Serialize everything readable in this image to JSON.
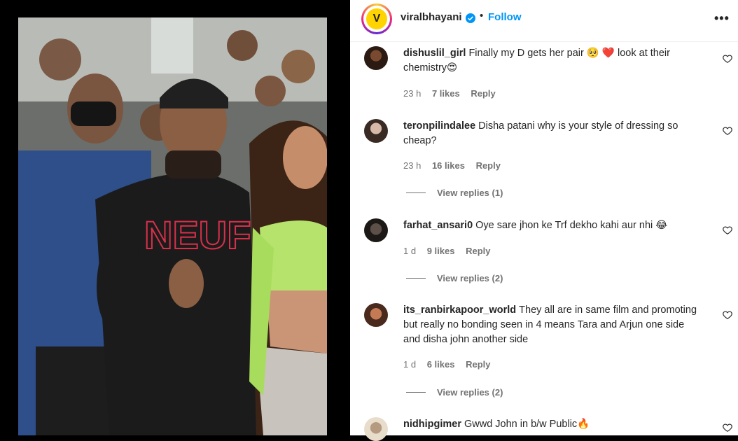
{
  "header": {
    "username": "viralbhayani",
    "separator": "•",
    "follow_label": "Follow",
    "more_label": "•••"
  },
  "comments": [
    {
      "username": "dishuslil_girl",
      "text": "Finally my D gets her pair 🥺 ❤️ look at their chemistry😍",
      "time": "23 h",
      "likes": "7 likes",
      "reply": "Reply",
      "view_replies": ""
    },
    {
      "username": "teronpilindalee",
      "text": "Disha patani why is your style of dressing so cheap?",
      "time": "23 h",
      "likes": "16 likes",
      "reply": "Reply",
      "view_replies": "View replies (1)"
    },
    {
      "username": "farhat_ansari0",
      "text": "Oye sare jhon ke Trf dekho kahi aur nhi 😂",
      "time": "1 d",
      "likes": "9 likes",
      "reply": "Reply",
      "view_replies": "View replies (2)"
    },
    {
      "username": "its_ranbirkapoor_world",
      "text": "They all are in same film and promoting but really no bonding seen in 4 means Tara and Arjun one side and disha john another side",
      "time": "1 d",
      "likes": "6 likes",
      "reply": "Reply",
      "view_replies": "View replies (2)"
    },
    {
      "username": "nidhipgimer",
      "text": "Gwwd John in b/w Public🔥",
      "time": "",
      "likes": "",
      "reply": "",
      "view_replies": ""
    }
  ],
  "video": {
    "shirt_text": "NEUF"
  },
  "colors": {
    "accent": "#0095f6",
    "text_primary": "#262626",
    "text_secondary": "#737373"
  },
  "icons": [
    "verified-icon",
    "heart-icon",
    "more-options-icon"
  ]
}
